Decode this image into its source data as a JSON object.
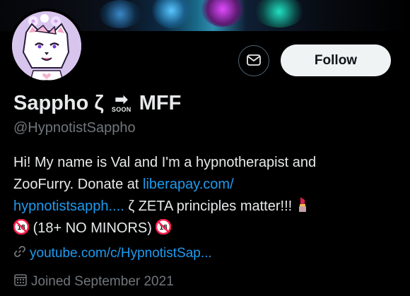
{
  "profile": {
    "display_name_left": "Sappho ζ",
    "display_name_badge": "SOON",
    "display_name_right": "MFF",
    "handle": "@HypnotistSappho",
    "bio": {
      "line1": "Hi! My name is Val and I'm a hypnotherapist and",
      "line2_text": "ZooFurry. Donate at ",
      "line2_link": "liberapay.com/",
      "line3_link": "hypnotistsapph....",
      "line3_text": " ζ ZETA principles matter!!!",
      "line4_text": "(18+ NO MINORS)"
    },
    "website": "youtube.com/c/HypnotistSap...",
    "joined": "Joined September 2021"
  },
  "actions": {
    "follow_label": "Follow"
  },
  "icons": {
    "message": "envelope-icon",
    "link": "link-icon",
    "calendar": "calendar-icon",
    "lipstick": "lipstick-icon",
    "no_minors": "no-under-18-icon",
    "soon_arrow": "soon-arrow-icon"
  },
  "colors": {
    "background": "#000000",
    "text": "#e7e9ea",
    "muted": "#71767b",
    "link": "#1d9bf0",
    "follow_bg": "#eff3f4",
    "no18_red": "#f91f4b"
  }
}
